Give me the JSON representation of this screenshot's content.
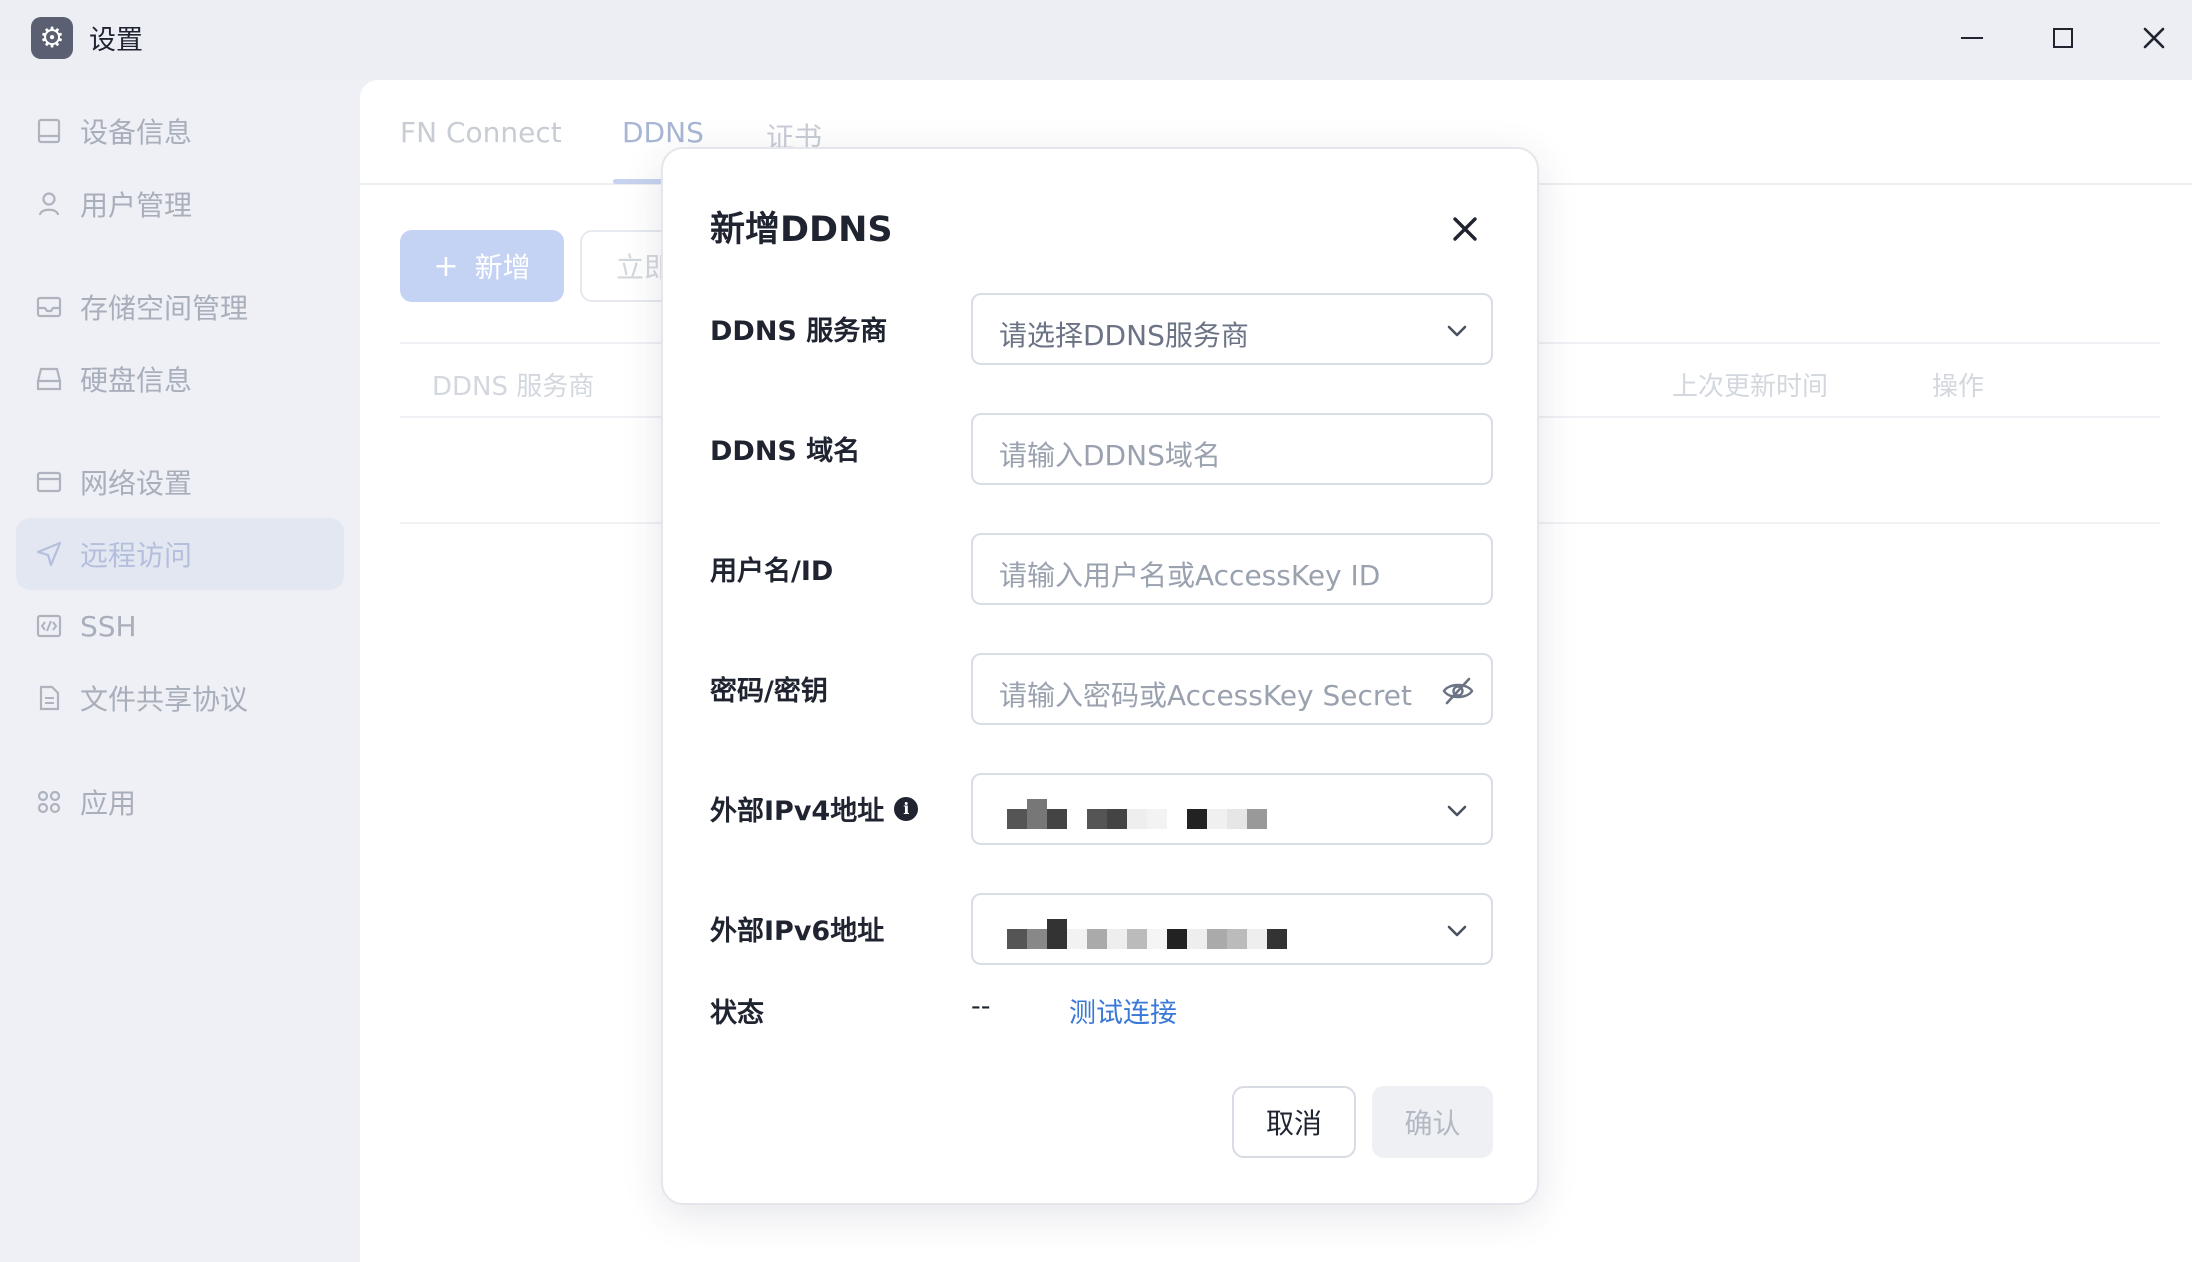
{
  "window": {
    "title": "设置"
  },
  "sidebar": {
    "items": [
      {
        "label": "设备信息",
        "icon": "device-icon"
      },
      {
        "label": "用户管理",
        "icon": "user-icon"
      },
      {
        "label": "存储空间管理",
        "icon": "storage-icon"
      },
      {
        "label": "硬盘信息",
        "icon": "disk-icon"
      },
      {
        "label": "网络设置",
        "icon": "network-icon"
      },
      {
        "label": "远程访问",
        "icon": "send-icon",
        "active": true
      },
      {
        "label": "SSH",
        "icon": "code-icon"
      },
      {
        "label": "文件共享协议",
        "icon": "document-icon"
      },
      {
        "label": "应用",
        "icon": "apps-icon"
      }
    ]
  },
  "tabs": [
    {
      "label": "FN Connect"
    },
    {
      "label": "DDNS",
      "active": true
    },
    {
      "label": "证书"
    }
  ],
  "toolbar": {
    "add_label": "新增",
    "now_label": "立即"
  },
  "table": {
    "columns": [
      "DDNS 服务商",
      "上次更新时间",
      "操作"
    ]
  },
  "dialog": {
    "title": "新增DDNS",
    "fields": {
      "provider": {
        "label": "DDNS 服务商",
        "placeholder": "请选择DDNS服务商"
      },
      "domain": {
        "label": "DDNS 域名",
        "placeholder": "请输入DDNS域名"
      },
      "username": {
        "label": "用户名/ID",
        "placeholder": "请输入用户名或AccessKey ID"
      },
      "password": {
        "label": "密码/密钥",
        "placeholder": "请输入密码或AccessKey Secret"
      },
      "ipv4": {
        "label": "外部IPv4地址"
      },
      "ipv6": {
        "label": "外部IPv6地址"
      }
    },
    "status": {
      "label": "状态",
      "value": "--",
      "test_link": "测试连接"
    },
    "cancel_label": "取消",
    "confirm_label": "确认"
  },
  "colors": {
    "accent": "#3a78d8",
    "add_button": "#c4d3f3",
    "background": "#eef0f5"
  }
}
